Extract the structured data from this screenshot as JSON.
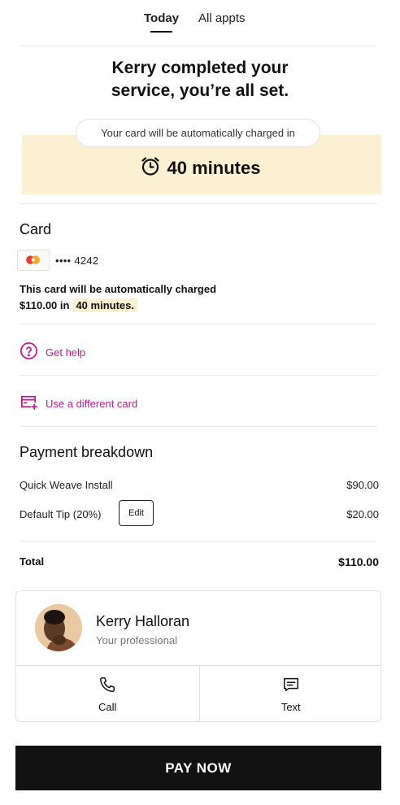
{
  "tabs": {
    "today": "Today",
    "all": "All appts"
  },
  "status": {
    "headline_line1": "Kerry completed your",
    "headline_line2": "service, you’re all set.",
    "pill_text": "Your card will be automatically charged in",
    "timer_text": "40 minutes",
    "timer_icon": "alarm-clock-icon"
  },
  "card": {
    "title": "Card",
    "brand_icon": "mastercard-icon",
    "number": "•••• 4242",
    "note_line1": "This card will be automatically charged",
    "note_amount": "$110.00 in",
    "note_highlight": "40 minutes."
  },
  "links": {
    "help": "Get help",
    "different_card": "Use a different card"
  },
  "breakdown": {
    "title": "Payment breakdown",
    "items": [
      {
        "label": "Quick Weave Install",
        "amount": "$90.00"
      },
      {
        "label": "Default Tip (20%)",
        "amount": "$20.00",
        "action": "Edit"
      }
    ],
    "total_label": "Total",
    "total_amount": "$110.00"
  },
  "professional": {
    "name": "Kerry Halloran",
    "role": "Your professional",
    "call_label": "Call",
    "text_label": "Text"
  },
  "pay_button": "PAY NOW",
  "colors": {
    "accent": "#c1188f",
    "highlight": "#fbf0d1",
    "button": "#121212"
  }
}
